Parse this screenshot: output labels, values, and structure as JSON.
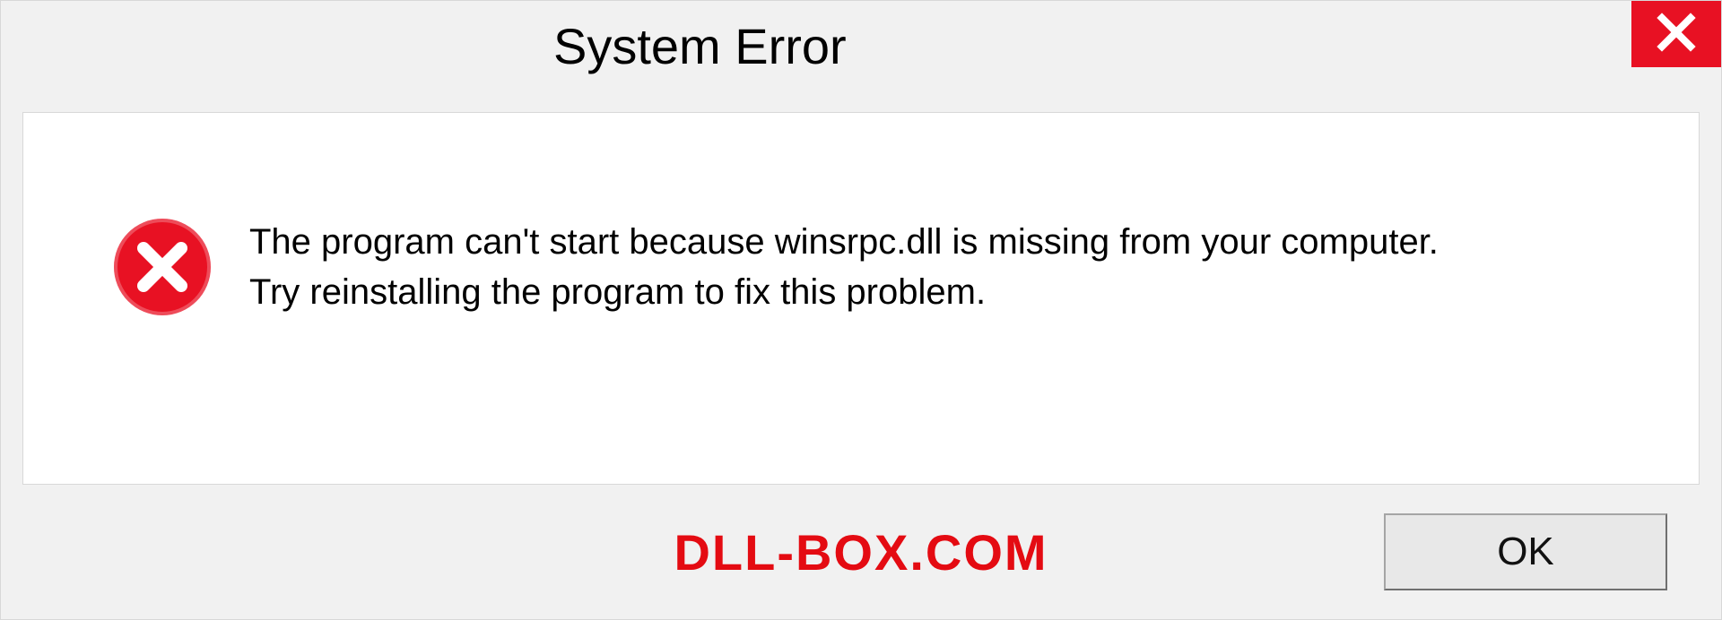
{
  "dialog": {
    "title": "System Error",
    "message_line1": "The program can't start because winsrpc.dll is missing from your computer.",
    "message_line2": "Try reinstalling the program to fix this problem.",
    "ok_label": "OK"
  },
  "watermark": "DLL-BOX.COM",
  "colors": {
    "error_red": "#e81123",
    "watermark_red": "#e40b12"
  }
}
